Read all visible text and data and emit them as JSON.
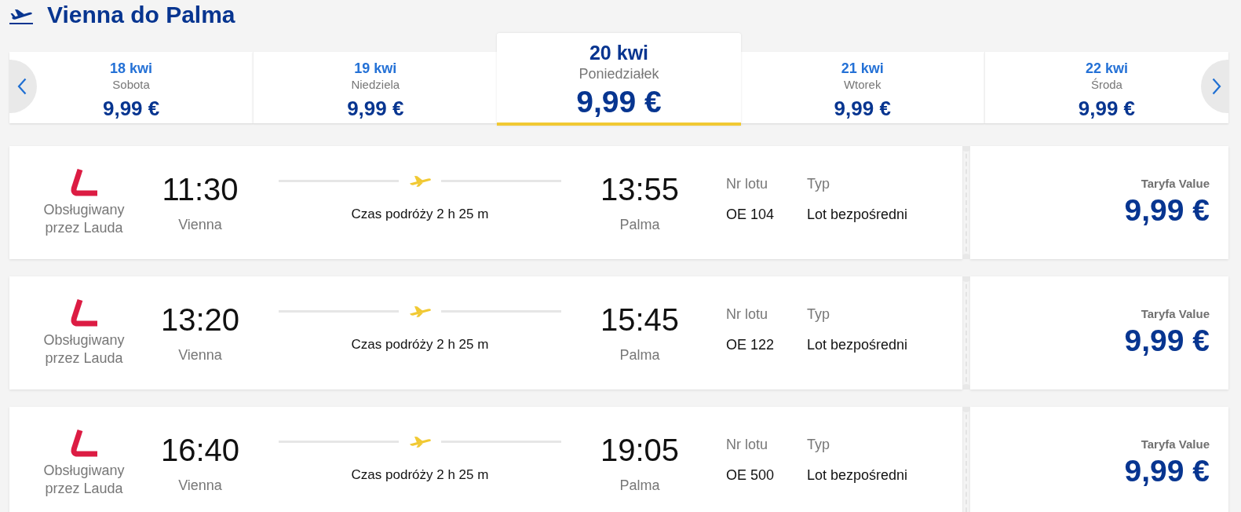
{
  "header": {
    "title": "Vienna do Palma"
  },
  "date_tabs": [
    {
      "date": "18 kwi",
      "weekday": "Sobota",
      "price": "9,99 €",
      "selected": false
    },
    {
      "date": "19 kwi",
      "weekday": "Niedziela",
      "price": "9,99 €",
      "selected": false
    },
    {
      "date": "20 kwi",
      "weekday": "Poniedziałek",
      "price": "9,99 €",
      "selected": true
    },
    {
      "date": "21 kwi",
      "weekday": "Wtorek",
      "price": "9,99 €",
      "selected": false
    },
    {
      "date": "22 kwi",
      "weekday": "Środa",
      "price": "9,99 €",
      "selected": false
    }
  ],
  "flights": [
    {
      "operator": "Obsługiwany przez Lauda",
      "departure_time": "11:30",
      "departure_city": "Vienna",
      "duration": "Czas podróży 2 h 25 m",
      "arrival_time": "13:55",
      "arrival_city": "Palma",
      "flight_number_label": "Nr lotu",
      "flight_number": "OE 104",
      "type_label": "Typ",
      "type": "Lot bezpośredni",
      "fare_label": "Taryfa Value",
      "price": "9,99 €"
    },
    {
      "operator": "Obsługiwany przez Lauda",
      "departure_time": "13:20",
      "departure_city": "Vienna",
      "duration": "Czas podróży 2 h 25 m",
      "arrival_time": "15:45",
      "arrival_city": "Palma",
      "flight_number_label": "Nr lotu",
      "flight_number": "OE 122",
      "type_label": "Typ",
      "type": "Lot bezpośredni",
      "fare_label": "Taryfa Value",
      "price": "9,99 €"
    },
    {
      "operator": "Obsługiwany przez Lauda",
      "departure_time": "16:40",
      "departure_city": "Vienna",
      "duration": "Czas podróży 2 h 25 m",
      "arrival_time": "19:05",
      "arrival_city": "Palma",
      "flight_number_label": "Nr lotu",
      "flight_number": "OE 500",
      "type_label": "Typ",
      "type": "Lot bezpośredni",
      "fare_label": "Taryfa Value",
      "price": "9,99 €"
    }
  ]
}
